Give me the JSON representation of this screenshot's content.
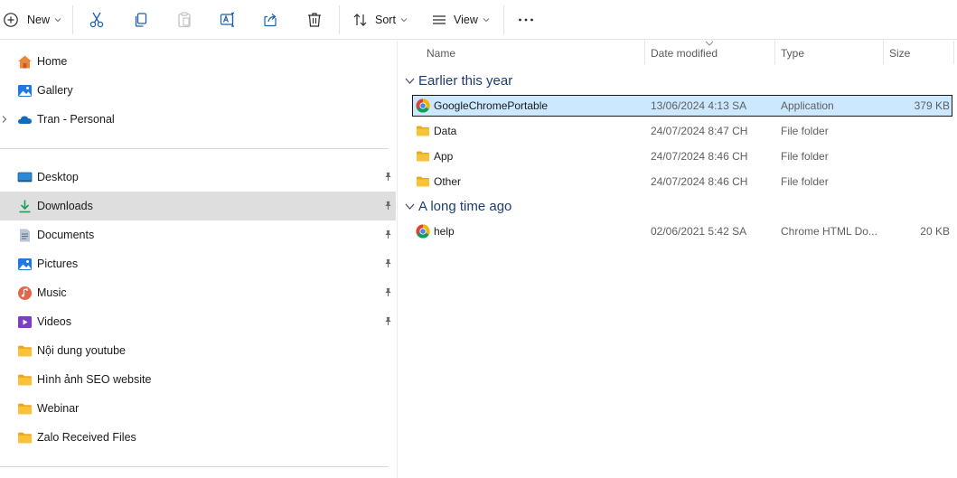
{
  "toolbar": {
    "new_label": "New",
    "sort_label": "Sort",
    "view_label": "View",
    "icons": [
      "add-icon",
      "cut-icon",
      "copy-icon",
      "paste-icon",
      "rename-icon",
      "share-icon",
      "delete-icon",
      "sort-icon",
      "view-icon",
      "more-icon"
    ]
  },
  "sidebar": {
    "top_items": [
      {
        "label": "Home",
        "icon": "home-icon"
      },
      {
        "label": "Gallery",
        "icon": "gallery-icon"
      },
      {
        "label": "Tran - Personal",
        "icon": "onedrive-cloud-icon"
      }
    ],
    "pinned_items": [
      {
        "label": "Desktop",
        "icon": "desktop-icon",
        "pinned": true
      },
      {
        "label": "Downloads",
        "icon": "download-icon",
        "pinned": true,
        "selected": true
      },
      {
        "label": "Documents",
        "icon": "documents-icon",
        "pinned": true
      },
      {
        "label": "Pictures",
        "icon": "pictures-icon",
        "pinned": true
      },
      {
        "label": "Music",
        "icon": "music-icon",
        "pinned": true
      },
      {
        "label": "Videos",
        "icon": "videos-icon",
        "pinned": true
      },
      {
        "label": "Nội dung youtube",
        "icon": "folder-icon",
        "pinned": false
      },
      {
        "label": "Hình ảnh SEO website",
        "icon": "folder-icon",
        "pinned": false
      },
      {
        "label": "Webinar",
        "icon": "folder-icon",
        "pinned": false
      },
      {
        "label": "Zalo Received Files",
        "icon": "folder-icon",
        "pinned": false
      }
    ]
  },
  "columns": {
    "name": "Name",
    "date": "Date modified",
    "type": "Type",
    "size": "Size"
  },
  "groups": [
    {
      "label": "Earlier this year",
      "files": [
        {
          "name": "GoogleChromePortable",
          "date": "13/06/2024 4:13 SA",
          "type": "Application",
          "size": "379 KB",
          "icon": "chrome-icon",
          "selected": true
        },
        {
          "name": "Data",
          "date": "24/07/2024 8:47 CH",
          "type": "File folder",
          "size": "",
          "icon": "folder-icon"
        },
        {
          "name": "App",
          "date": "24/07/2024 8:46 CH",
          "type": "File folder",
          "size": "",
          "icon": "folder-icon"
        },
        {
          "name": "Other",
          "date": "24/07/2024 8:46 CH",
          "type": "File folder",
          "size": "",
          "icon": "folder-icon"
        }
      ]
    },
    {
      "label": "A long time ago",
      "files": [
        {
          "name": "help",
          "date": "02/06/2021 5:42 SA",
          "type": "Chrome HTML Do...",
          "size": "20 KB",
          "icon": "chrome-icon"
        }
      ]
    }
  ],
  "colors": {
    "selection_bg": "#cce8ff",
    "sidebar_selected_bg": "#dedede",
    "group_header": "#1e3e6e",
    "folder_yellow": "#f8c23a"
  }
}
